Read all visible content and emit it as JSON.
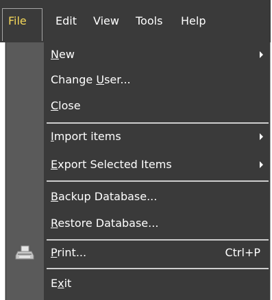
{
  "menubar": {
    "items": [
      {
        "label": "File"
      },
      {
        "label": "Edit"
      },
      {
        "label": "View"
      },
      {
        "label": "Tools"
      },
      {
        "label": "Help"
      }
    ]
  },
  "file_menu": {
    "items": [
      {
        "pre": "",
        "acc": "N",
        "post": "ew",
        "submenu": true
      },
      {
        "pre": "Change ",
        "acc": "U",
        "post": "ser...",
        "submenu": false
      },
      {
        "pre": "",
        "acc": "C",
        "post": "lose",
        "submenu": false
      },
      {
        "pre": "",
        "acc": "I",
        "post": "mport items",
        "submenu": true
      },
      {
        "pre": "",
        "acc": "E",
        "post": "xport Selected Items",
        "submenu": true
      },
      {
        "pre": "",
        "acc": "B",
        "post": "ackup Database...",
        "submenu": false
      },
      {
        "pre": "",
        "acc": "R",
        "post": "estore Database...",
        "submenu": false
      },
      {
        "pre": "",
        "acc": "P",
        "post": "rint...",
        "submenu": false,
        "shortcut": "Ctrl+P",
        "icon": "printer-icon"
      },
      {
        "pre": "E",
        "acc": "x",
        "post": "it",
        "submenu": false
      }
    ]
  },
  "colors": {
    "menu_bg": "#3a3a3a",
    "gutter_bg": "#5a5a5a",
    "active_text": "#f5d85a",
    "text": "#ffffff"
  }
}
